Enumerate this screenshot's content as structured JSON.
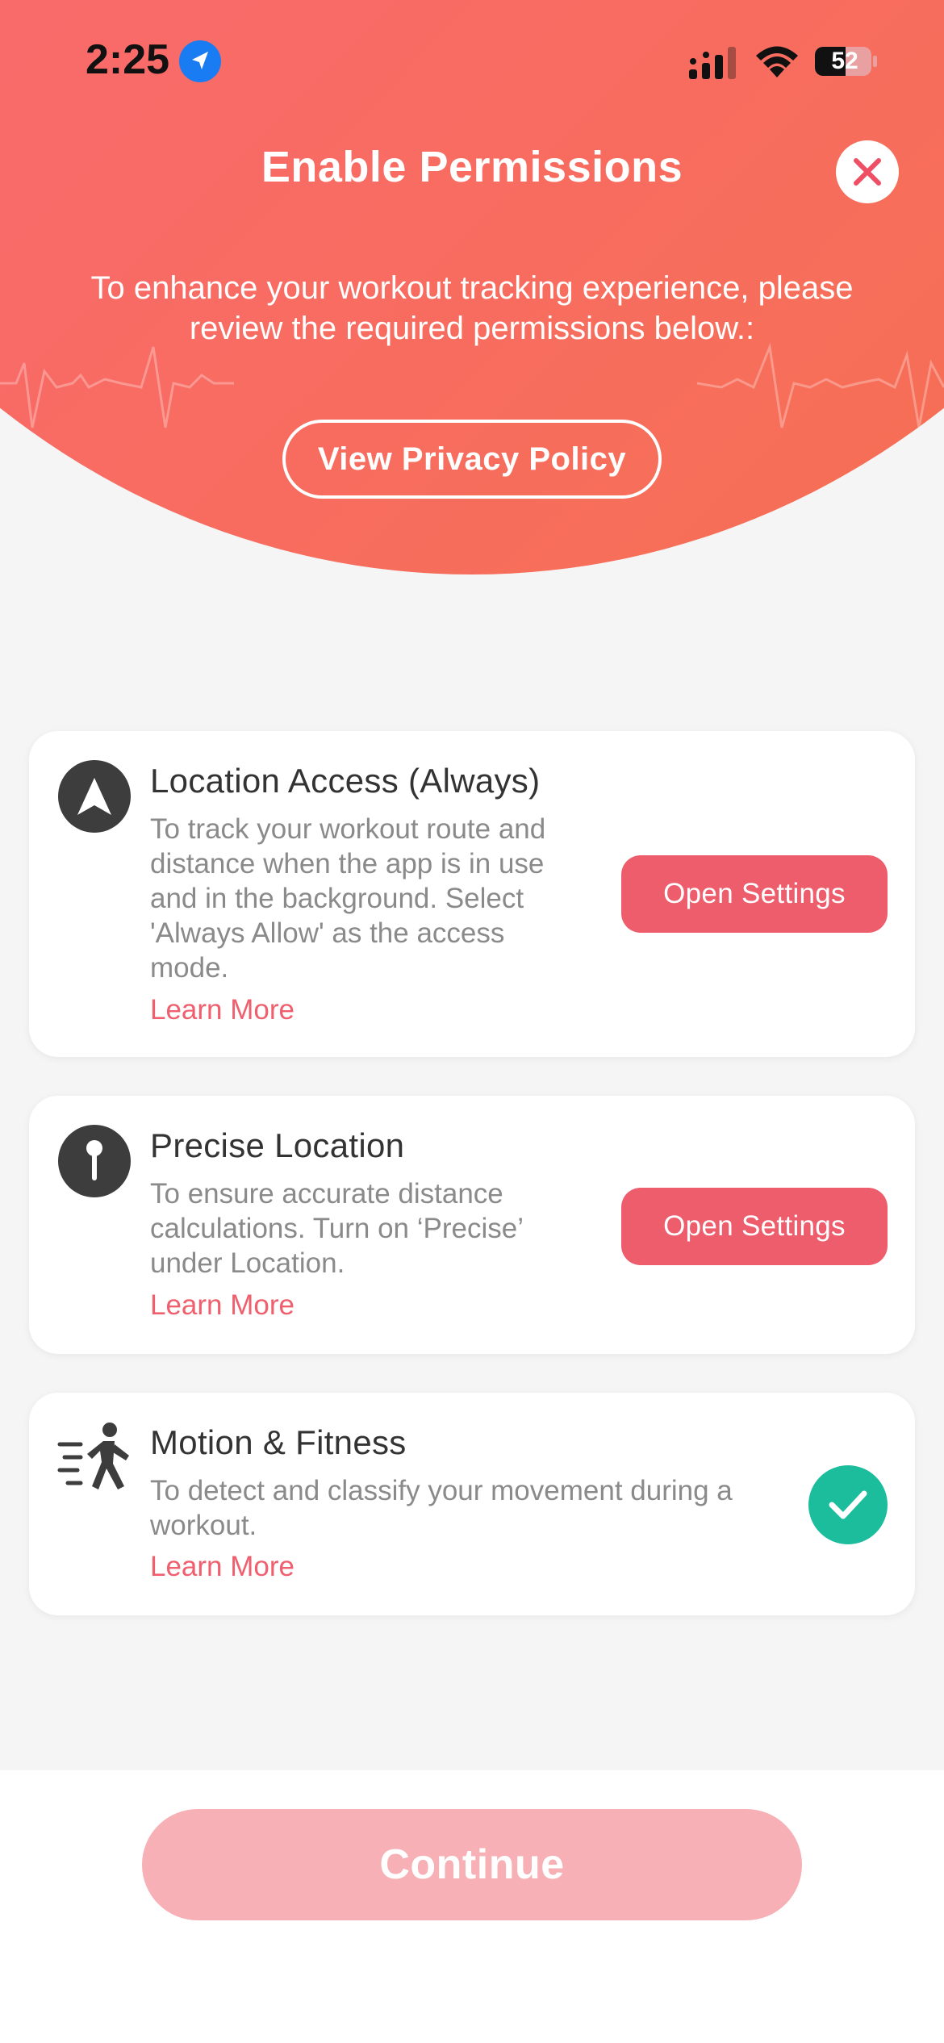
{
  "status_bar": {
    "time": "2:25",
    "battery": "52"
  },
  "header": {
    "title": "Enable Permissions",
    "subtitle": "To enhance your workout tracking experience, please review the required permissions below.:",
    "privacy_button": "View Privacy Policy"
  },
  "permissions": [
    {
      "title": "Location Access (Always)",
      "description": "To track your workout route and distance when the app is in use and in the background. Select 'Always Allow' as the access mode.",
      "learn_more": "Learn More",
      "action": "Open Settings",
      "icon": "navigation-arrow-icon",
      "granted": false
    },
    {
      "title": "Precise Location",
      "description": "To ensure accurate distance calculations. Turn on ‘Precise’ under Location.",
      "learn_more": "Learn More",
      "action": "Open Settings",
      "icon": "location-pin-icon",
      "granted": false
    },
    {
      "title": "Motion & Fitness",
      "description": "To detect and classify your movement during a workout.",
      "learn_more": "Learn More",
      "icon": "running-person-icon",
      "granted": true
    }
  ],
  "footer": {
    "continue_label": "Continue"
  },
  "colors": {
    "header_gradient_start": "#fb6c7d",
    "header_gradient_end": "#f6704f",
    "accent": "#ed5d6c",
    "granted": "#1bbd9c",
    "continue_disabled": "#f7b0b5"
  }
}
